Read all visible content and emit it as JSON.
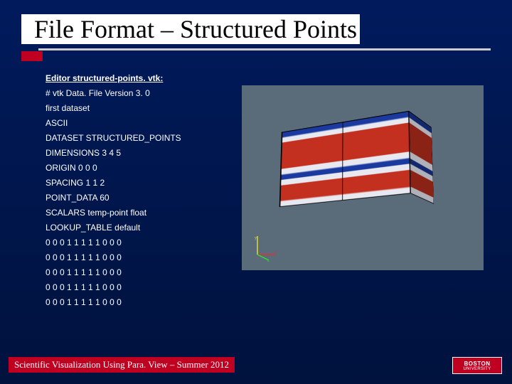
{
  "title": "File Format – Structured Points",
  "editor_label": "Editor structured-points. vtk:",
  "file_lines": [
    "# vtk Data. File Version 3. 0",
    "first dataset",
    "ASCII",
    "DATASET STRUCTURED_POINTS",
    "DIMENSIONS 3 4 5",
    "ORIGIN 0 0 0",
    "SPACING 1 1 2",
    "POINT_DATA 60",
    "SCALARS temp-point float",
    "LOOKUP_TABLE default",
    "0 0 0 1 1 1 1 1 0 0 0",
    "0 0 0 1 1 1 1 1 0 0 0",
    "0 0 0 1 1 1 1 1 0 0 0",
    "0 0 0 1 1 1 1 1 0 0 0",
    "0 0 0 1 1 1 1 1 0 0 0"
  ],
  "footer": "Scientific Visualization Using Para. View – Summer 2012",
  "logo": {
    "line1": "BOSTON",
    "line2": "UNIVERSITY"
  }
}
